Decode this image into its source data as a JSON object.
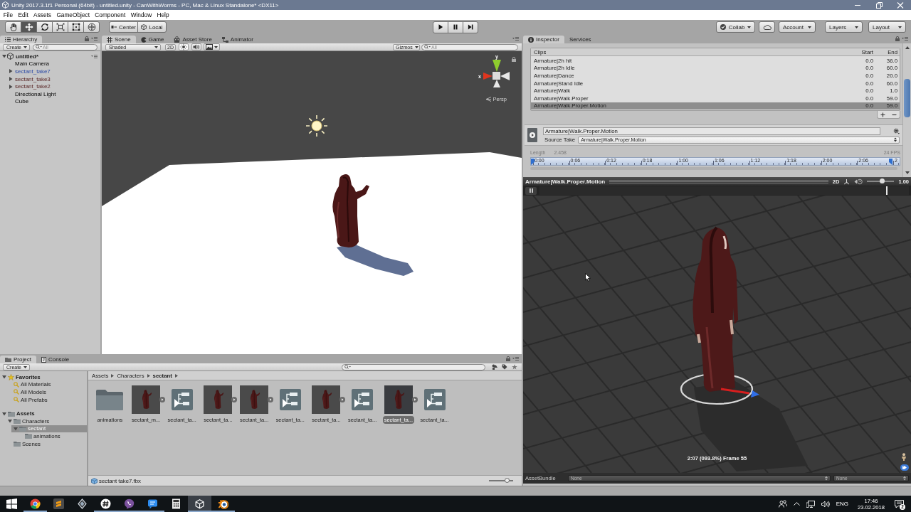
{
  "window": {
    "title": "Unity 2017.3.1f1 Personal (64bit) - untitled.unity - CanWithWorms - PC, Mac & Linux Standalone* <DX11>"
  },
  "menu": [
    {
      "label": "File"
    },
    {
      "label": "Edit"
    },
    {
      "label": "Assets"
    },
    {
      "label": "GameObject"
    },
    {
      "label": "Component"
    },
    {
      "label": "Window"
    },
    {
      "label": "Help"
    }
  ],
  "toolbar": {
    "tools": [
      {
        "kind": "hand",
        "selected": false
      },
      {
        "kind": "move",
        "selected": true
      },
      {
        "kind": "rotate",
        "selected": false
      },
      {
        "kind": "scale",
        "selected": false
      },
      {
        "kind": "rect",
        "selected": false
      },
      {
        "kind": "transform",
        "selected": false
      }
    ],
    "pivot": [
      {
        "kind": "center",
        "label": "Center"
      },
      {
        "kind": "local",
        "label": "Local"
      }
    ],
    "playback": [
      {
        "kind": "play"
      },
      {
        "kind": "pause"
      },
      {
        "kind": "step"
      }
    ],
    "services": [
      {
        "kind": "collab",
        "label": "Collab"
      },
      {
        "kind": "cloud"
      },
      {
        "kind": "dropdown",
        "label": "Account"
      },
      {
        "kind": "dropdown",
        "label": "Layers"
      },
      {
        "kind": "dropdown",
        "label": "Layout"
      }
    ]
  },
  "hierarchy": {
    "tabs": [
      {
        "kind": "hierarchy",
        "label": "Hierarchy",
        "selected": true
      }
    ],
    "create": "Create",
    "search": {
      "placeholder": "All"
    },
    "scenes": [
      {
        "name": "untitled*",
        "expanded": true,
        "selected": false,
        "children": [
          {
            "name": "Main Camera",
            "kind": "object",
            "selected": false
          },
          {
            "name": "sectant_take7",
            "kind": "prefab",
            "expanded": false,
            "selected": false
          },
          {
            "name": "sectant_take3",
            "kind": "missing_prefab",
            "expanded": false,
            "selected": false
          },
          {
            "name": "sectant_take2",
            "kind": "missing_prefab",
            "expanded": false,
            "selected": false
          },
          {
            "name": "Directional Light",
            "kind": "object",
            "selected": false
          },
          {
            "name": "Cube",
            "kind": "object",
            "selected": false
          }
        ]
      }
    ]
  },
  "scene_view": {
    "tabs": [
      {
        "kind": "scene",
        "label": "Scene",
        "selected": true
      },
      {
        "kind": "game",
        "label": "Game",
        "selected": false
      },
      {
        "kind": "store",
        "label": "Asset Store",
        "selected": false
      },
      {
        "kind": "animator",
        "label": "Animator",
        "selected": false
      }
    ],
    "shading": "Shaded",
    "mode_2d": {
      "label": "2D",
      "on": false
    },
    "toggles": [
      {
        "kind": "lighting",
        "on": true
      },
      {
        "kind": "audio",
        "on": false
      },
      {
        "kind": "effects",
        "on": false
      }
    ],
    "gizmos": "Gizmos",
    "search": {
      "placeholder": "All"
    },
    "gizmo_axes": {
      "y": "y",
      "x": "x"
    },
    "projection": "Persp"
  },
  "project": {
    "tabs": [
      {
        "kind": "project",
        "label": "Project",
        "selected": true
      },
      {
        "kind": "console",
        "label": "Console",
        "selected": false
      }
    ],
    "create": "Create",
    "tree": [
      {
        "kind": "favorites",
        "label": "Favorites",
        "expanded": true,
        "selected": false,
        "children": [
          {
            "kind": "search",
            "label": "All Materials",
            "selected": false
          },
          {
            "kind": "search",
            "label": "All Models",
            "selected": false
          },
          {
            "kind": "search",
            "label": "All Prefabs",
            "selected": false
          }
        ]
      },
      {
        "kind": "root",
        "label": "Assets",
        "expanded": true,
        "selected": false,
        "children": [
          {
            "kind": "folder",
            "label": "Characters",
            "expanded": true,
            "selected": false,
            "children": [
              {
                "kind": "folder",
                "label": "sectant",
                "expanded": true,
                "selected": true,
                "children": [
                  {
                    "kind": "folder",
                    "label": "animations",
                    "selected": false
                  }
                ]
              }
            ]
          },
          {
            "kind": "folder",
            "label": "Scenes",
            "selected": false
          }
        ]
      }
    ],
    "breadcrumb": [
      {
        "label": "Assets"
      },
      {
        "label": "Characters"
      },
      {
        "label": "sectant"
      }
    ],
    "assets": [
      {
        "kind": "folder",
        "label": "animations",
        "selected": false
      },
      {
        "kind": "model",
        "label": "sectant_m...",
        "selected": false
      },
      {
        "kind": "controller",
        "label": "sectant_ta...",
        "selected": false
      },
      {
        "kind": "model",
        "label": "sectant_ta...",
        "selected": false
      },
      {
        "kind": "model",
        "label": "sectant_ta...",
        "selected": false
      },
      {
        "kind": "controller",
        "label": "sectant_ta...",
        "selected": false
      },
      {
        "kind": "model",
        "label": "sectant_ta...",
        "selected": false
      },
      {
        "kind": "controller",
        "label": "sectant_ta...",
        "selected": false
      },
      {
        "kind": "model",
        "label": "sectant_ta...",
        "selected": true
      },
      {
        "kind": "controller",
        "label": "sectant_ta...",
        "selected": false
      }
    ],
    "footer": {
      "file": "sectant take7.fbx",
      "zoom": {
        "level": 0.75
      }
    }
  },
  "inspector": {
    "tabs": [
      {
        "kind": "inspector",
        "label": "Inspector",
        "selected": true
      },
      {
        "kind": "services",
        "label": "Services",
        "selected": false
      }
    ],
    "clips": {
      "columns": [
        {
          "label": "Clips"
        },
        {
          "label": "Start"
        },
        {
          "label": "End"
        }
      ],
      "rows": [
        {
          "name": "Armature|2h hit",
          "start": "0.0",
          "end": "36.0",
          "selected": false
        },
        {
          "name": "Armature|2h Idle",
          "start": "0.0",
          "end": "60.0",
          "selected": false
        },
        {
          "name": "Armature|Dance",
          "start": "0.0",
          "end": "20.0",
          "selected": false
        },
        {
          "name": "Armature|Stand Idle",
          "start": "0.0",
          "end": "60.0",
          "selected": false
        },
        {
          "name": "Armature|Walk",
          "start": "0.0",
          "end": "1.0",
          "selected": false
        },
        {
          "name": "Armature|Walk.Proper",
          "start": "0.0",
          "end": "59.0",
          "selected": false
        },
        {
          "name": "Armature|Walk.Proper.Motion",
          "start": "0.0",
          "end": "59.0",
          "selected": true
        }
      ]
    },
    "clip": {
      "name": "Armature|Walk.Proper.Motion",
      "source_label": "Source Take",
      "source": "Armature|Walk.Proper.Motion",
      "length_label": "Length",
      "length": "2.458",
      "fps": "24 FPS",
      "ticks": [
        "0:00",
        "0:06",
        "0:12",
        "0:18",
        "1:00",
        "1:06",
        "1:12",
        "1:18",
        "2:00",
        "2:06",
        "2"
      ]
    },
    "preview": {
      "title": "Armature|Walk.Proper.Motion",
      "mode": "2D",
      "speed": {
        "level": 0.55
      },
      "speed_reading": "1.00",
      "playhead": {
        "level": 0.938
      },
      "status": "2:07 (093.8%) Frame 55"
    },
    "asset_bundle": {
      "label": "AssetBundle",
      "name": "None",
      "variant": "None"
    }
  },
  "taskbar": {
    "apps": [
      {
        "kind": "start",
        "running": false,
        "selected": false
      },
      {
        "kind": "browser",
        "running": true,
        "selected": false
      },
      {
        "kind": "editor",
        "running": false,
        "selected": false
      },
      {
        "kind": "diamond",
        "running": false,
        "selected": false
      },
      {
        "kind": "hash",
        "running": true,
        "selected": false
      },
      {
        "kind": "phone",
        "running": true,
        "selected": false
      },
      {
        "kind": "chat",
        "running": true,
        "selected": false
      },
      {
        "kind": "calculator",
        "running": false,
        "selected": false
      },
      {
        "kind": "cube",
        "running": true,
        "selected": true
      },
      {
        "kind": "orbit",
        "running": true,
        "selected": false
      }
    ],
    "tray": {
      "language": "ENG",
      "time": "17:46",
      "date": "23.02.2018",
      "notifications": "2"
    }
  }
}
